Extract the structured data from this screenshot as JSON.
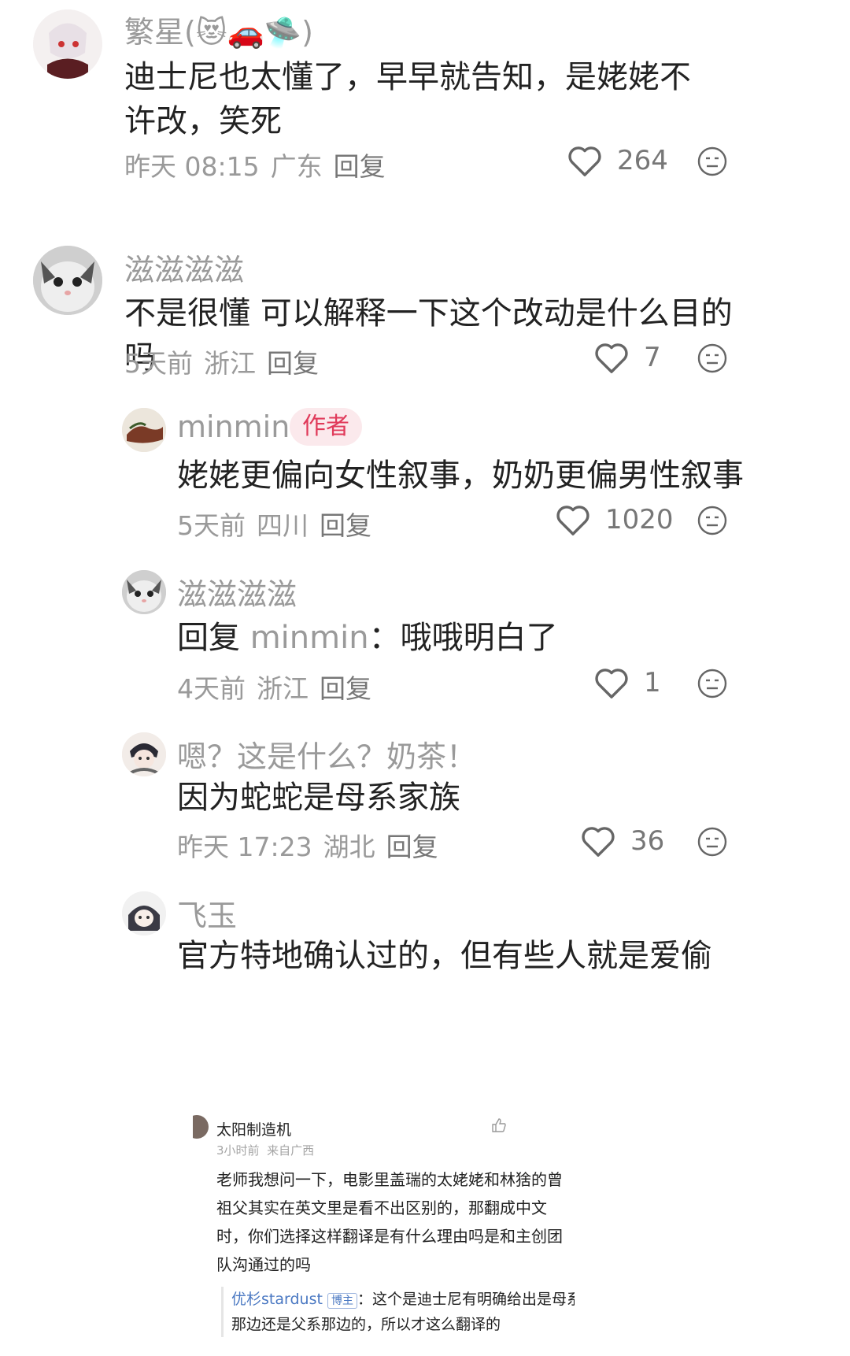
{
  "comments": [
    {
      "user": "繁星(😻🚗🛸)",
      "text": "迪士尼也太懂了，早早就告知，是姥姥不许改，笑死",
      "time": "昨天 08:15",
      "location": "广东",
      "reply": "回复",
      "likes": "264"
    },
    {
      "user": "滋滋滋滋",
      "text": "不是很懂 可以解释一下这个改动是什么目的吗",
      "time": "5天前",
      "location": "浙江",
      "reply": "回复",
      "likes": "7"
    },
    {
      "user": "minmin",
      "badge": "作者",
      "text": "姥姥更偏向女性叙事，奶奶更偏男性叙事",
      "time": "5天前",
      "location": "四川",
      "reply": "回复",
      "likes": "1020"
    },
    {
      "user": "滋滋滋滋",
      "reply_prefix": "回复",
      "reply_to": "minmin",
      "text": "：哦哦明白了",
      "time": "4天前",
      "location": "浙江",
      "reply": "回复",
      "likes": "1"
    },
    {
      "user": "嗯？这是什么？奶茶！",
      "text": "因为蛇蛇是母系家族",
      "time": "昨天 17:23",
      "location": "湖北",
      "reply": "回复",
      "likes": "36"
    },
    {
      "user": "飞玉",
      "text": "官方特地确认过的，但有些人就是爱偷"
    }
  ],
  "embedded": {
    "name": "太阳制造机",
    "time": "3小时前",
    "source": "来自广西",
    "body": "老师我想问一下，电影里盖瑞的太姥姥和林猞的曾祖父其实在英文里是看不出区别的，那翻成中文时，你们选择这样翻译是有什么理由吗是和主创团队沟通过的吗",
    "quote_name": "优杉stardust",
    "quote_badge": "博主",
    "quote_text": "：这个是迪士尼有明确给出是母系那边还是父系那边的，所以才这么翻译的"
  }
}
